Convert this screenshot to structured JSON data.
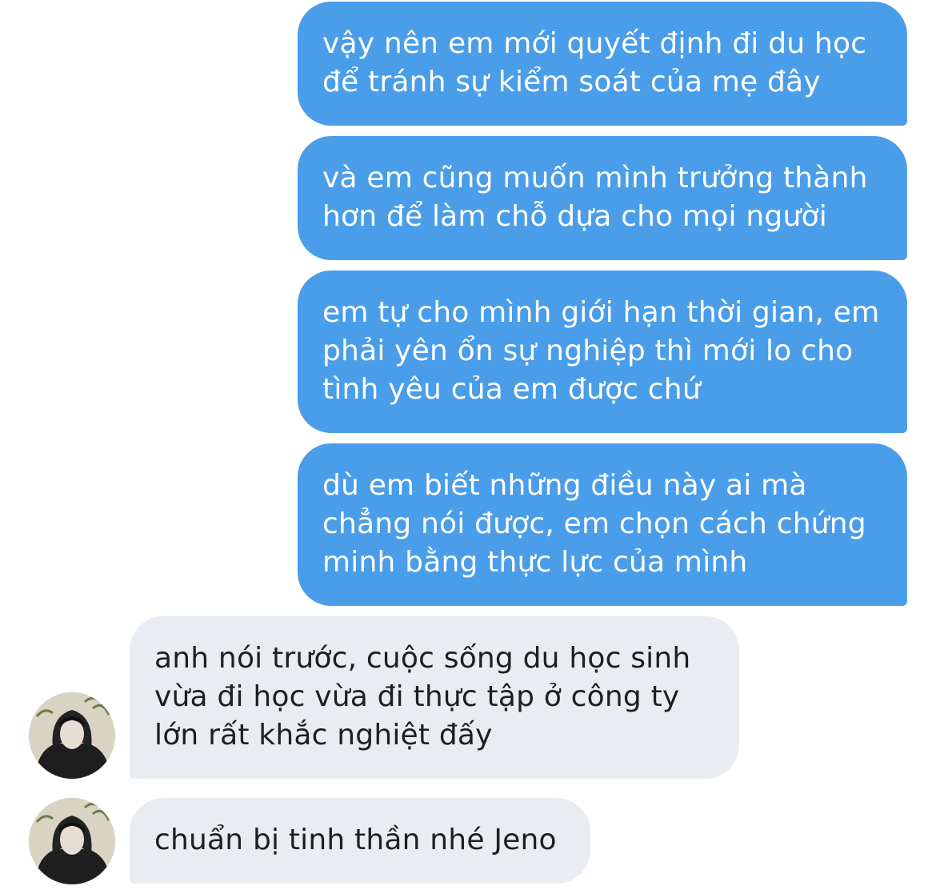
{
  "colors": {
    "sent_bubble": "#4a9de8",
    "received_bubble": "#e9edf1",
    "sent_text": "#ffffff",
    "received_text": "#1f1f1f"
  },
  "messages": [
    {
      "direction": "sent",
      "lines": [
        "vậy nên em mới quyết định đi du học",
        "để tránh sự kiểm soát của mẹ đây"
      ]
    },
    {
      "direction": "sent",
      "lines": [
        "và em cũng muốn mình trưởng thành",
        "hơn để làm chỗ dựa cho mọi người"
      ]
    },
    {
      "direction": "sent",
      "lines": [
        "em tự cho mình giới hạn thời gian, em",
        "phải yên ổn sự nghiệp thì mới lo cho",
        "tình yêu của em được chứ"
      ]
    },
    {
      "direction": "sent",
      "lines": [
        "dù em biết những điều này ai mà",
        "chẳng nói được, em chọn cách chứng",
        "minh bằng thực lực của mình"
      ]
    },
    {
      "direction": "received",
      "lines": [
        "anh nói trước, cuộc sống du học sinh",
        "vừa đi học vừa đi thực tập ở công ty",
        "lớn rất khắc nghiệt đấy"
      ]
    },
    {
      "direction": "received",
      "lines": [
        "chuẩn bị tinh thần nhé Jeno"
      ]
    }
  ],
  "avatar_icon": "user-avatar-photo"
}
